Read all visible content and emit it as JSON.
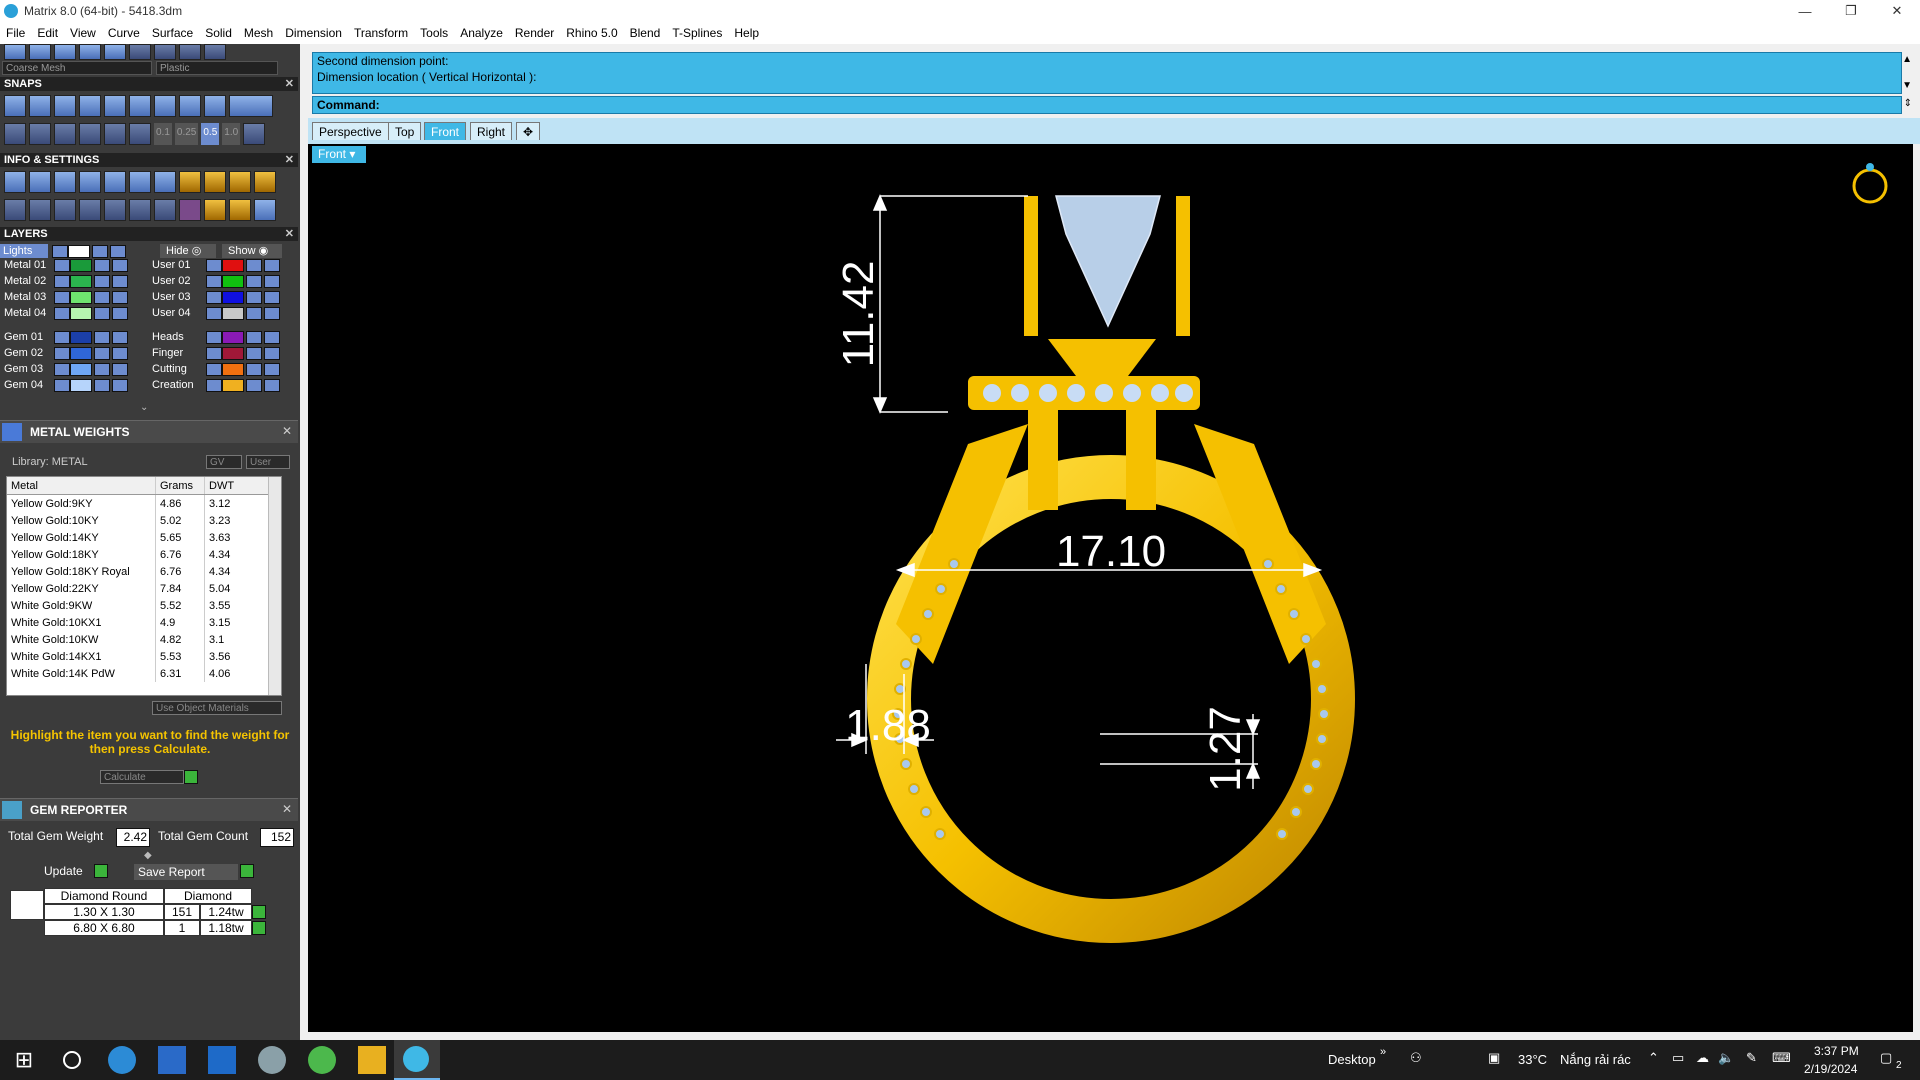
{
  "window": {
    "title": "Matrix 8.0 (64-bit) - 5418.3dm",
    "controls": [
      "—",
      "❐",
      "✕"
    ]
  },
  "menu": [
    "File",
    "Edit",
    "View",
    "Curve",
    "Surface",
    "Solid",
    "Mesh",
    "Dimension",
    "Transform",
    "Tools",
    "Analyze",
    "Render",
    "Rhino 5.0",
    "Blend",
    "T-Splines",
    "Help"
  ],
  "top_dropdowns": {
    "mesh": "Coarse Mesh",
    "material": "Plastic"
  },
  "snaps": {
    "title": "SNAPS",
    "steps": [
      "0.1",
      "0.25",
      "0.5",
      "1.0"
    ]
  },
  "info_settings": {
    "title": "INFO & SETTINGS"
  },
  "layers": {
    "title": "LAYERS",
    "lights_label": "Lights",
    "hide_label": "Hide",
    "show_label": "Show",
    "left": [
      {
        "name": "Metal 01",
        "color": "#1a9a3a"
      },
      {
        "name": "Metal 02",
        "color": "#2bb54e"
      },
      {
        "name": "Metal 03",
        "color": "#6fe46f"
      },
      {
        "name": "Metal 04",
        "color": "#b6f5b0"
      },
      {
        "name": "Gem 01",
        "color": "#1b3fa8"
      },
      {
        "name": "Gem 02",
        "color": "#2f66d8"
      },
      {
        "name": "Gem 03",
        "color": "#6ea6f5"
      },
      {
        "name": "Gem 04",
        "color": "#b6d4fb"
      }
    ],
    "right": [
      {
        "name": "User 01",
        "color": "#e01010"
      },
      {
        "name": "User 02",
        "color": "#10c010"
      },
      {
        "name": "User 03",
        "color": "#1010e0"
      },
      {
        "name": "User 04",
        "color": "#c8c8c8"
      },
      {
        "name": "Heads",
        "color": "#8a1ab5"
      },
      {
        "name": "Finger",
        "color": "#a01838"
      },
      {
        "name": "Cutting",
        "color": "#f07010"
      },
      {
        "name": "Creation",
        "color": "#f0b020"
      }
    ]
  },
  "metal_weights": {
    "title": "METAL WEIGHTS",
    "library": "Library: METAL",
    "btn_gv": "GV",
    "btn_user": "User",
    "columns": [
      "Metal",
      "Grams",
      "DWT"
    ],
    "rows": [
      [
        "Yellow Gold:9KY",
        "4.86",
        "3.12"
      ],
      [
        "Yellow Gold:10KY",
        "5.02",
        "3.23"
      ],
      [
        "Yellow Gold:14KY",
        "5.65",
        "3.63"
      ],
      [
        "Yellow Gold:18KY",
        "6.76",
        "4.34"
      ],
      [
        "Yellow Gold:18KY Royal",
        "6.76",
        "4.34"
      ],
      [
        "Yellow Gold:22KY",
        "7.84",
        "5.04"
      ],
      [
        "White Gold:9KW",
        "5.52",
        "3.55"
      ],
      [
        "White Gold:10KX1",
        "4.9",
        "3.15"
      ],
      [
        "White Gold:10KW",
        "4.82",
        "3.1"
      ],
      [
        "White Gold:14KX1",
        "5.53",
        "3.56"
      ],
      [
        "White Gold:14K PdW",
        "6.31",
        "4.06"
      ]
    ],
    "use_object_materials": "Use Object Materials",
    "hint": "Highlight the item you want to find the weight for then press Calculate.",
    "calculate": "Calculate"
  },
  "gem_reporter": {
    "title": "GEM REPORTER",
    "total_weight_label": "Total Gem Weight",
    "total_weight": "2.42",
    "total_count_label": "Total Gem Count",
    "total_count": "152",
    "update": "Update",
    "save_report": "Save Report",
    "col_shape": "Diamond Round",
    "col_material": "Diamond",
    "rows": [
      [
        "1.30 X 1.30",
        "151",
        "1.24tw"
      ],
      [
        "6.80 X 6.80",
        "1",
        "1.18tw"
      ]
    ]
  },
  "command": {
    "history": [
      "Second dimension point:",
      "Dimension location ( Vertical  Horizontal ):"
    ],
    "prompt": "Command:"
  },
  "tabs": [
    "Perspective",
    "Top",
    "Front",
    "Right",
    "✥"
  ],
  "active_tab": "Front",
  "viewport_label": "Front",
  "dimensions": {
    "height": "11.42",
    "inner_diameter": "17.10",
    "band_width": "1.88",
    "band_thickness": "1.27"
  },
  "taskbar": {
    "desktop": "Desktop",
    "temperature": "33°C",
    "weather": "Nắng rải rác",
    "time": "3:37 PM",
    "date": "2/19/2024",
    "notifications": "2"
  }
}
